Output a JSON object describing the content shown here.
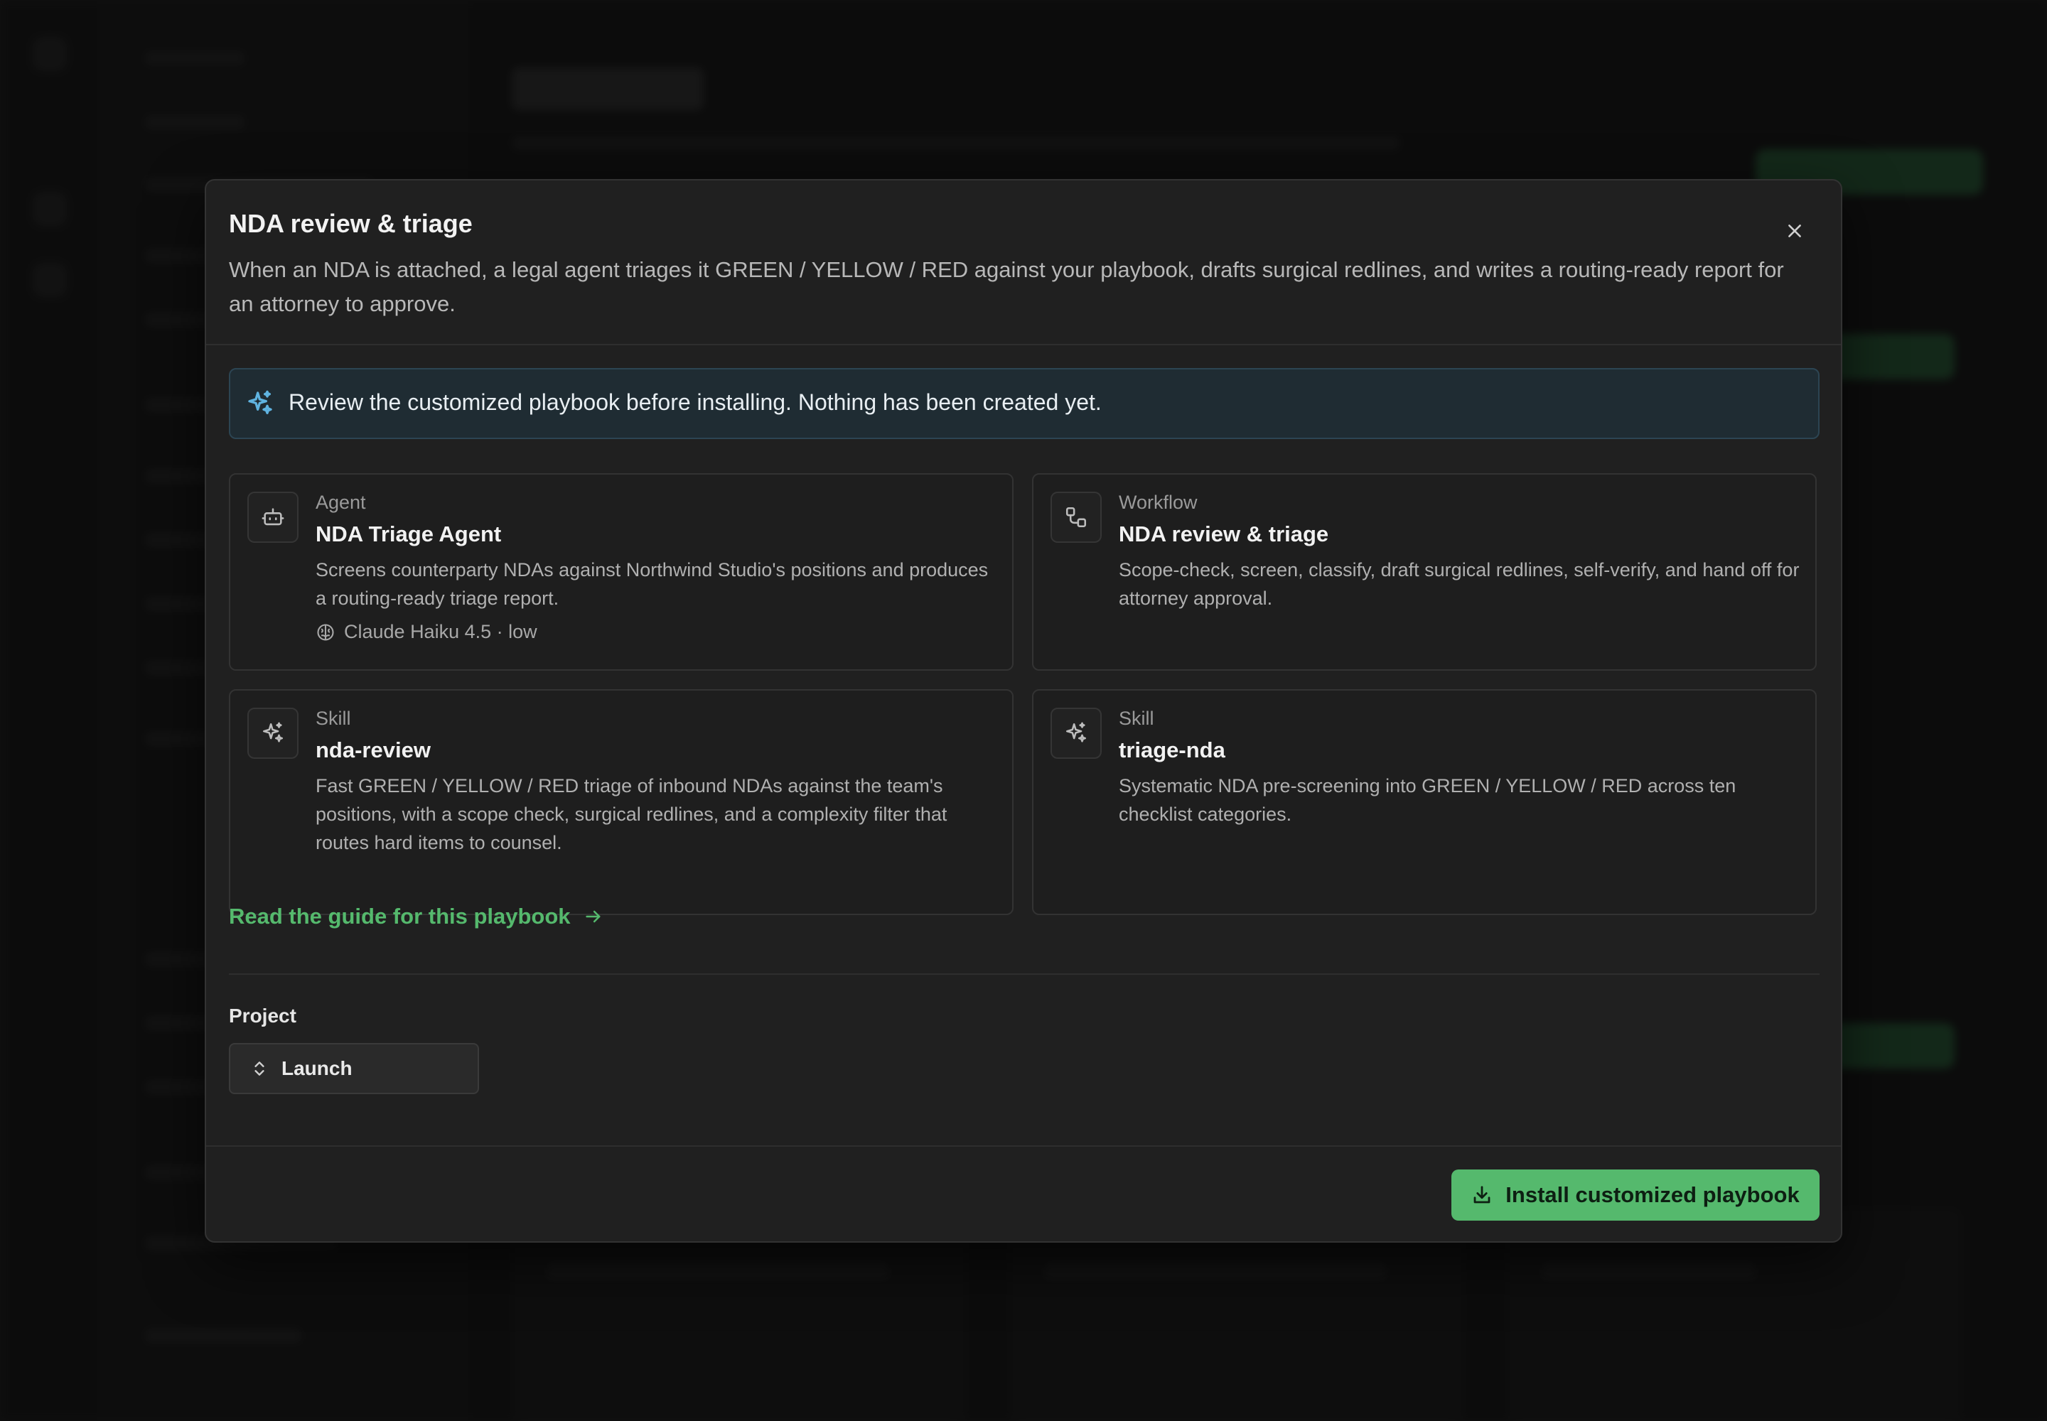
{
  "modal": {
    "title": "NDA review & triage",
    "description": "When an NDA is attached, a legal agent triages it GREEN / YELLOW / RED against your playbook, drafts surgical redlines, and writes a routing-ready report for an attorney to approve.",
    "close_icon": "close-icon"
  },
  "notice": {
    "icon": "sparkles-icon",
    "text": "Review the customized playbook before installing. Nothing has been created yet."
  },
  "cards": [
    {
      "kind": "Agent",
      "name": "NDA Triage Agent",
      "description": "Screens counterparty NDAs against Northwind Studio's positions and produces a routing-ready triage report.",
      "meta": "Claude Haiku 4.5 · low",
      "icon": "robot-icon",
      "meta_icon": "brain-icon"
    },
    {
      "kind": "Workflow",
      "name": "NDA review & triage",
      "description": "Scope-check, screen, classify, draft surgical redlines, self-verify, and hand off for attorney approval.",
      "icon": "workflow-icon"
    },
    {
      "kind": "Skill",
      "name": "nda-review",
      "description": "Fast GREEN / YELLOW / RED triage of inbound NDAs against the team's positions, with a scope check, surgical redlines, and a complexity filter that routes hard items to counsel.",
      "icon": "sparkles-icon"
    },
    {
      "kind": "Skill",
      "name": "triage-nda",
      "description": "Systematic NDA pre-screening into GREEN / YELLOW / RED across ten checklist categories.",
      "icon": "sparkles-icon"
    }
  ],
  "guide_link": {
    "label": "Read the guide for this playbook",
    "icon": "arrow-right-icon"
  },
  "project": {
    "label": "Project",
    "selected": "Launch",
    "icon": "chevron-up-down-icon"
  },
  "install_button": {
    "label": "Install customized playbook",
    "icon": "download-icon"
  },
  "colors": {
    "accent": "#55b96d",
    "modal_bg": "#202020",
    "notice_bg": "#1f2c33"
  }
}
